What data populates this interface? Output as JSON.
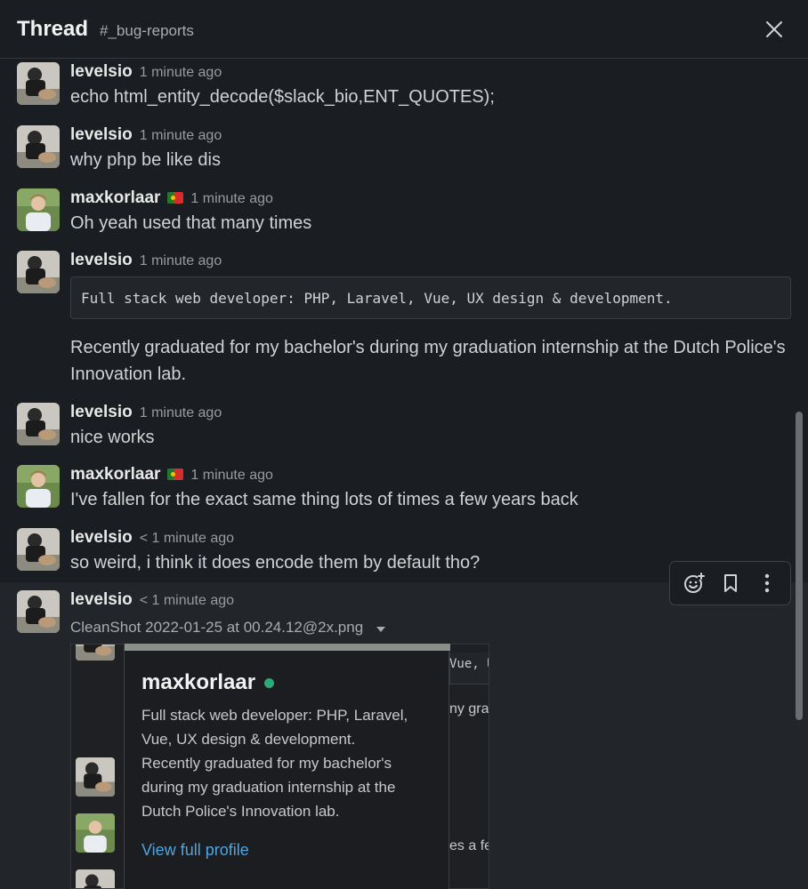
{
  "header": {
    "title": "Thread",
    "channel": "#_bug-reports"
  },
  "messages": [
    {
      "author": "levelsio",
      "time": "1 minute ago",
      "text": "echo html_entity_decode($slack_bio,ENT_QUOTES);"
    },
    {
      "author": "levelsio",
      "time": "1 minute ago",
      "text": "why php be like dis"
    },
    {
      "author": "maxkorlaar",
      "time": "1 minute ago",
      "text": "Oh yeah used that many times"
    },
    {
      "author": "levelsio",
      "time": "1 minute ago",
      "code": "Full stack web developer: PHP, Laravel, Vue, UX design & development.",
      "text_line1": "Recently graduated for my bachelor's during my graduation internship at the Dutch Police's",
      "text_line2": "Innovation lab."
    },
    {
      "author": "levelsio",
      "time": "1 minute ago",
      "text": "nice works"
    },
    {
      "author": "maxkorlaar",
      "time": "1 minute ago",
      "text": "I've fallen for the exact same thing lots of times a few years back"
    },
    {
      "author": "levelsio",
      "time": "< 1 minute ago",
      "text": "so weird, i think it does encode them by default tho?"
    },
    {
      "author": "levelsio",
      "time": "< 1 minute ago",
      "file": "CleanShot 2022-01-25 at 00.24.12@2x.png"
    }
  ],
  "profile_card": {
    "name": "maxkorlaar",
    "bio_lines": [
      "Full stack web developer: PHP, Laravel,",
      "Vue, UX design & development.",
      "Recently graduated for my bachelor's",
      "during my graduation internship at the",
      "Dutch Police's Innovation lab."
    ],
    "link": "View full profile"
  },
  "preview_fragments": {
    "code_peek": "Vue, U",
    "text_peek_1": "ny gra",
    "text_peek_2": "es a fe"
  },
  "toolbar": {
    "icons": [
      "add-reaction-icon",
      "bookmark-icon",
      "more-actions-icon"
    ]
  },
  "colors": {
    "background": "#1a1d21",
    "link": "#4ea6e0",
    "online": "#2bac76"
  }
}
